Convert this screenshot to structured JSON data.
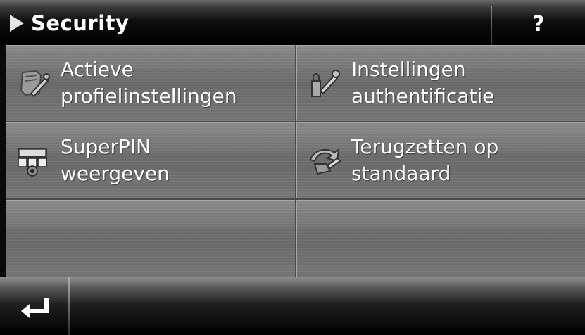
{
  "header": {
    "title": "Security",
    "help_label": "?"
  },
  "menu": {
    "items": [
      {
        "line1": "Actieve",
        "line2": "profielinstellingen",
        "icon": "profile-settings-icon"
      },
      {
        "line1": "Instellingen",
        "line2": "authentificatie",
        "icon": "authentication-settings-icon"
      },
      {
        "line1": "SuperPIN",
        "line2": "weergeven",
        "icon": "superpin-icon"
      },
      {
        "line1": "Terugzetten op",
        "line2": "standaard",
        "icon": "reset-default-icon"
      }
    ]
  },
  "footer": {
    "back_icon": "back-arrow-icon"
  }
}
